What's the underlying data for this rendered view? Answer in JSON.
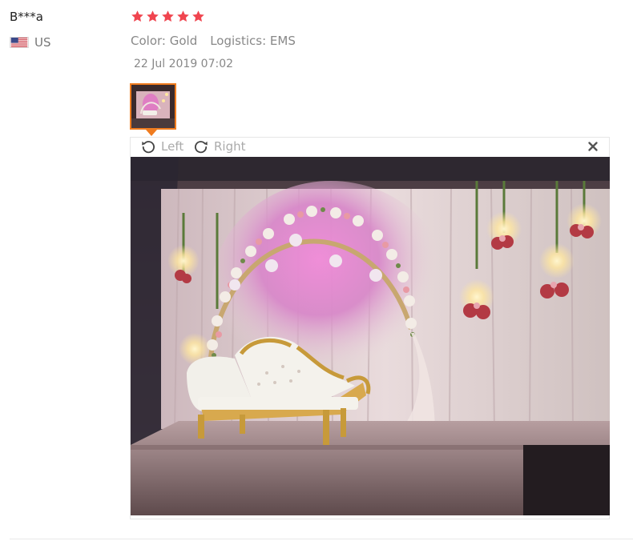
{
  "reviewer": {
    "name": "B***a",
    "country": "US",
    "flag_icon": "us-flag-icon"
  },
  "rating": {
    "stars": 5,
    "max": 5,
    "color": "#f0454f"
  },
  "meta": {
    "color": "Color: Gold",
    "logistics": "Logistics: EMS"
  },
  "date": "22 Jul 2019 07:02",
  "viewer": {
    "rotate_left_label": "Left",
    "rotate_right_label": "Right",
    "close_icon": "close-icon",
    "accent": "#f07c1f"
  }
}
